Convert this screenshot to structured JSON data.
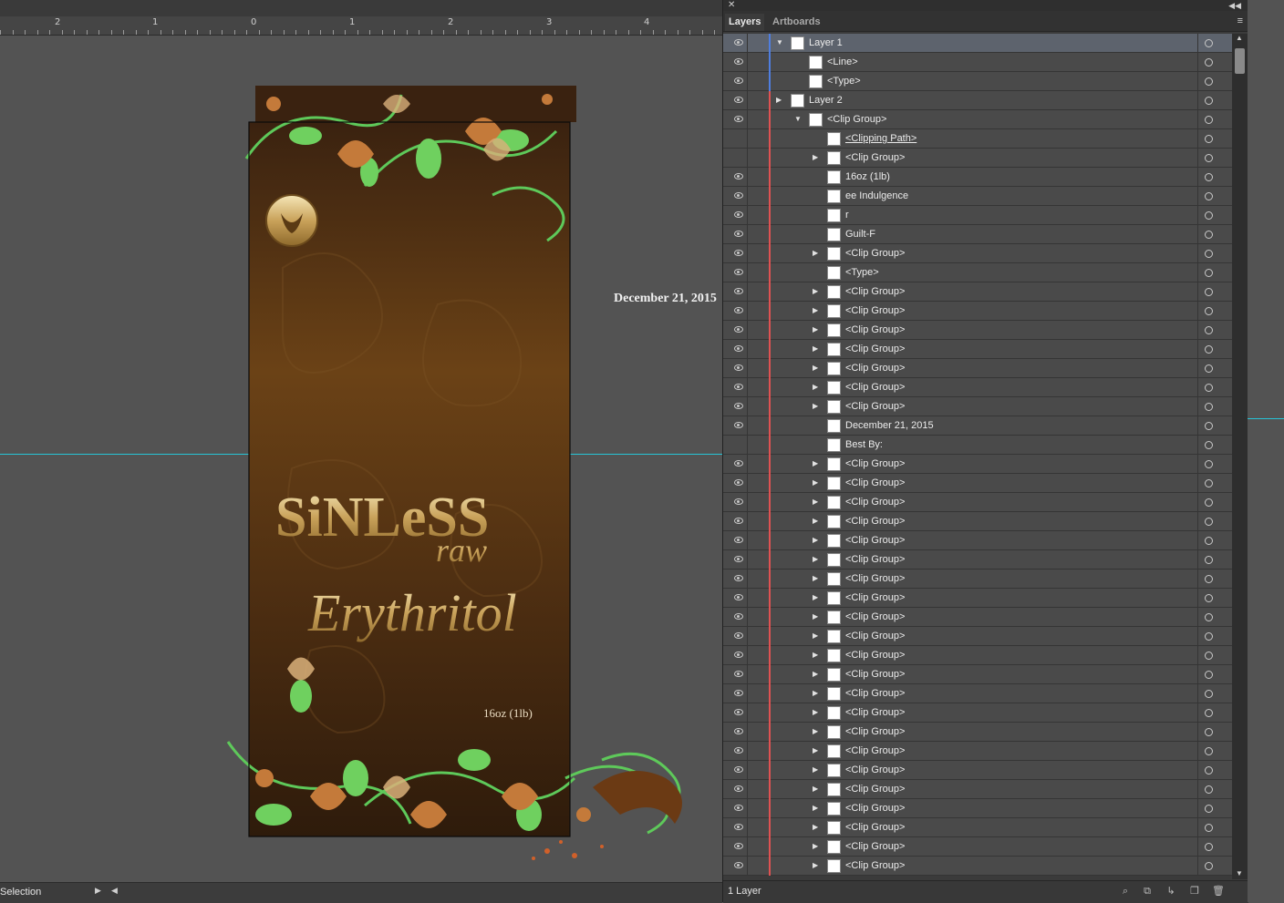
{
  "ruler": {
    "numbers": [
      "2",
      "1",
      "0",
      "1",
      "2",
      "3",
      "4"
    ]
  },
  "canvas": {
    "date_text": "December 21, 2015",
    "weight_text": "16oz (1lb)",
    "brand_title": "SiNLeSS",
    "brand_sub": "raw",
    "product_name": "Erythritol"
  },
  "status": {
    "tool": "Selection"
  },
  "panel": {
    "tabs": [
      "Layers",
      "Artboards"
    ],
    "footer_count": "1 Layer",
    "colors": {
      "layer1": "#4f7ee0",
      "layer2": "#e05252",
      "selected_row": "#5d636d"
    },
    "rows": [
      {
        "name": "Layer 1",
        "level": 0,
        "eye": true,
        "tri": "down",
        "sel": true
      },
      {
        "name": "<Line>",
        "level": 1,
        "eye": true,
        "tri": ""
      },
      {
        "name": "<Type>",
        "level": 1,
        "eye": true,
        "tri": ""
      },
      {
        "name": "Layer 2",
        "level": 0,
        "eye": true,
        "tri": "right"
      },
      {
        "name": "<Clip Group>",
        "level": 1,
        "eye": true,
        "tri": "down"
      },
      {
        "name": "<Clipping Path>",
        "level": 2,
        "eye": false,
        "tri": "",
        "underline": true
      },
      {
        "name": "<Clip Group>",
        "level": 2,
        "eye": false,
        "tri": "right"
      },
      {
        "name": "16oz (1lb)",
        "level": 2,
        "eye": true,
        "tri": ""
      },
      {
        "name": "ee Indulgence",
        "level": 2,
        "eye": true,
        "tri": ""
      },
      {
        "name": "r",
        "level": 2,
        "eye": true,
        "tri": ""
      },
      {
        "name": "Guilt-F",
        "level": 2,
        "eye": true,
        "tri": ""
      },
      {
        "name": "<Clip Group>",
        "level": 2,
        "eye": true,
        "tri": "right"
      },
      {
        "name": "<Type>",
        "level": 2,
        "eye": true,
        "tri": ""
      },
      {
        "name": "<Clip Group>",
        "level": 2,
        "eye": true,
        "tri": "right"
      },
      {
        "name": "<Clip Group>",
        "level": 2,
        "eye": true,
        "tri": "right"
      },
      {
        "name": "<Clip Group>",
        "level": 2,
        "eye": true,
        "tri": "right"
      },
      {
        "name": "<Clip Group>",
        "level": 2,
        "eye": true,
        "tri": "right"
      },
      {
        "name": "<Clip Group>",
        "level": 2,
        "eye": true,
        "tri": "right"
      },
      {
        "name": "<Clip Group>",
        "level": 2,
        "eye": true,
        "tri": "right"
      },
      {
        "name": "<Clip Group>",
        "level": 2,
        "eye": true,
        "tri": "right"
      },
      {
        "name": "December 21, 2015",
        "level": 2,
        "eye": true,
        "tri": ""
      },
      {
        "name": "Best By:",
        "level": 2,
        "eye": false,
        "tri": ""
      },
      {
        "name": "<Clip Group>",
        "level": 2,
        "eye": true,
        "tri": "right"
      },
      {
        "name": "<Clip Group>",
        "level": 2,
        "eye": true,
        "tri": "right"
      },
      {
        "name": "<Clip Group>",
        "level": 2,
        "eye": true,
        "tri": "right"
      },
      {
        "name": "<Clip Group>",
        "level": 2,
        "eye": true,
        "tri": "right"
      },
      {
        "name": "<Clip Group>",
        "level": 2,
        "eye": true,
        "tri": "right"
      },
      {
        "name": "<Clip Group>",
        "level": 2,
        "eye": true,
        "tri": "right"
      },
      {
        "name": "<Clip Group>",
        "level": 2,
        "eye": true,
        "tri": "right"
      },
      {
        "name": "<Clip Group>",
        "level": 2,
        "eye": true,
        "tri": "right"
      },
      {
        "name": "<Clip Group>",
        "level": 2,
        "eye": true,
        "tri": "right"
      },
      {
        "name": "<Clip Group>",
        "level": 2,
        "eye": true,
        "tri": "right"
      },
      {
        "name": "<Clip Group>",
        "level": 2,
        "eye": true,
        "tri": "right"
      },
      {
        "name": "<Clip Group>",
        "level": 2,
        "eye": true,
        "tri": "right"
      },
      {
        "name": "<Clip Group>",
        "level": 2,
        "eye": true,
        "tri": "right"
      },
      {
        "name": "<Clip Group>",
        "level": 2,
        "eye": true,
        "tri": "right"
      },
      {
        "name": "<Clip Group>",
        "level": 2,
        "eye": true,
        "tri": "right"
      },
      {
        "name": "<Clip Group>",
        "level": 2,
        "eye": true,
        "tri": "right"
      },
      {
        "name": "<Clip Group>",
        "level": 2,
        "eye": true,
        "tri": "right"
      },
      {
        "name": "<Clip Group>",
        "level": 2,
        "eye": true,
        "tri": "right"
      },
      {
        "name": "<Clip Group>",
        "level": 2,
        "eye": true,
        "tri": "right"
      },
      {
        "name": "<Clip Group>",
        "level": 2,
        "eye": true,
        "tri": "right"
      },
      {
        "name": "<Clip Group>",
        "level": 2,
        "eye": true,
        "tri": "right"
      },
      {
        "name": "<Clip Group>",
        "level": 2,
        "eye": true,
        "tri": "right"
      }
    ]
  }
}
